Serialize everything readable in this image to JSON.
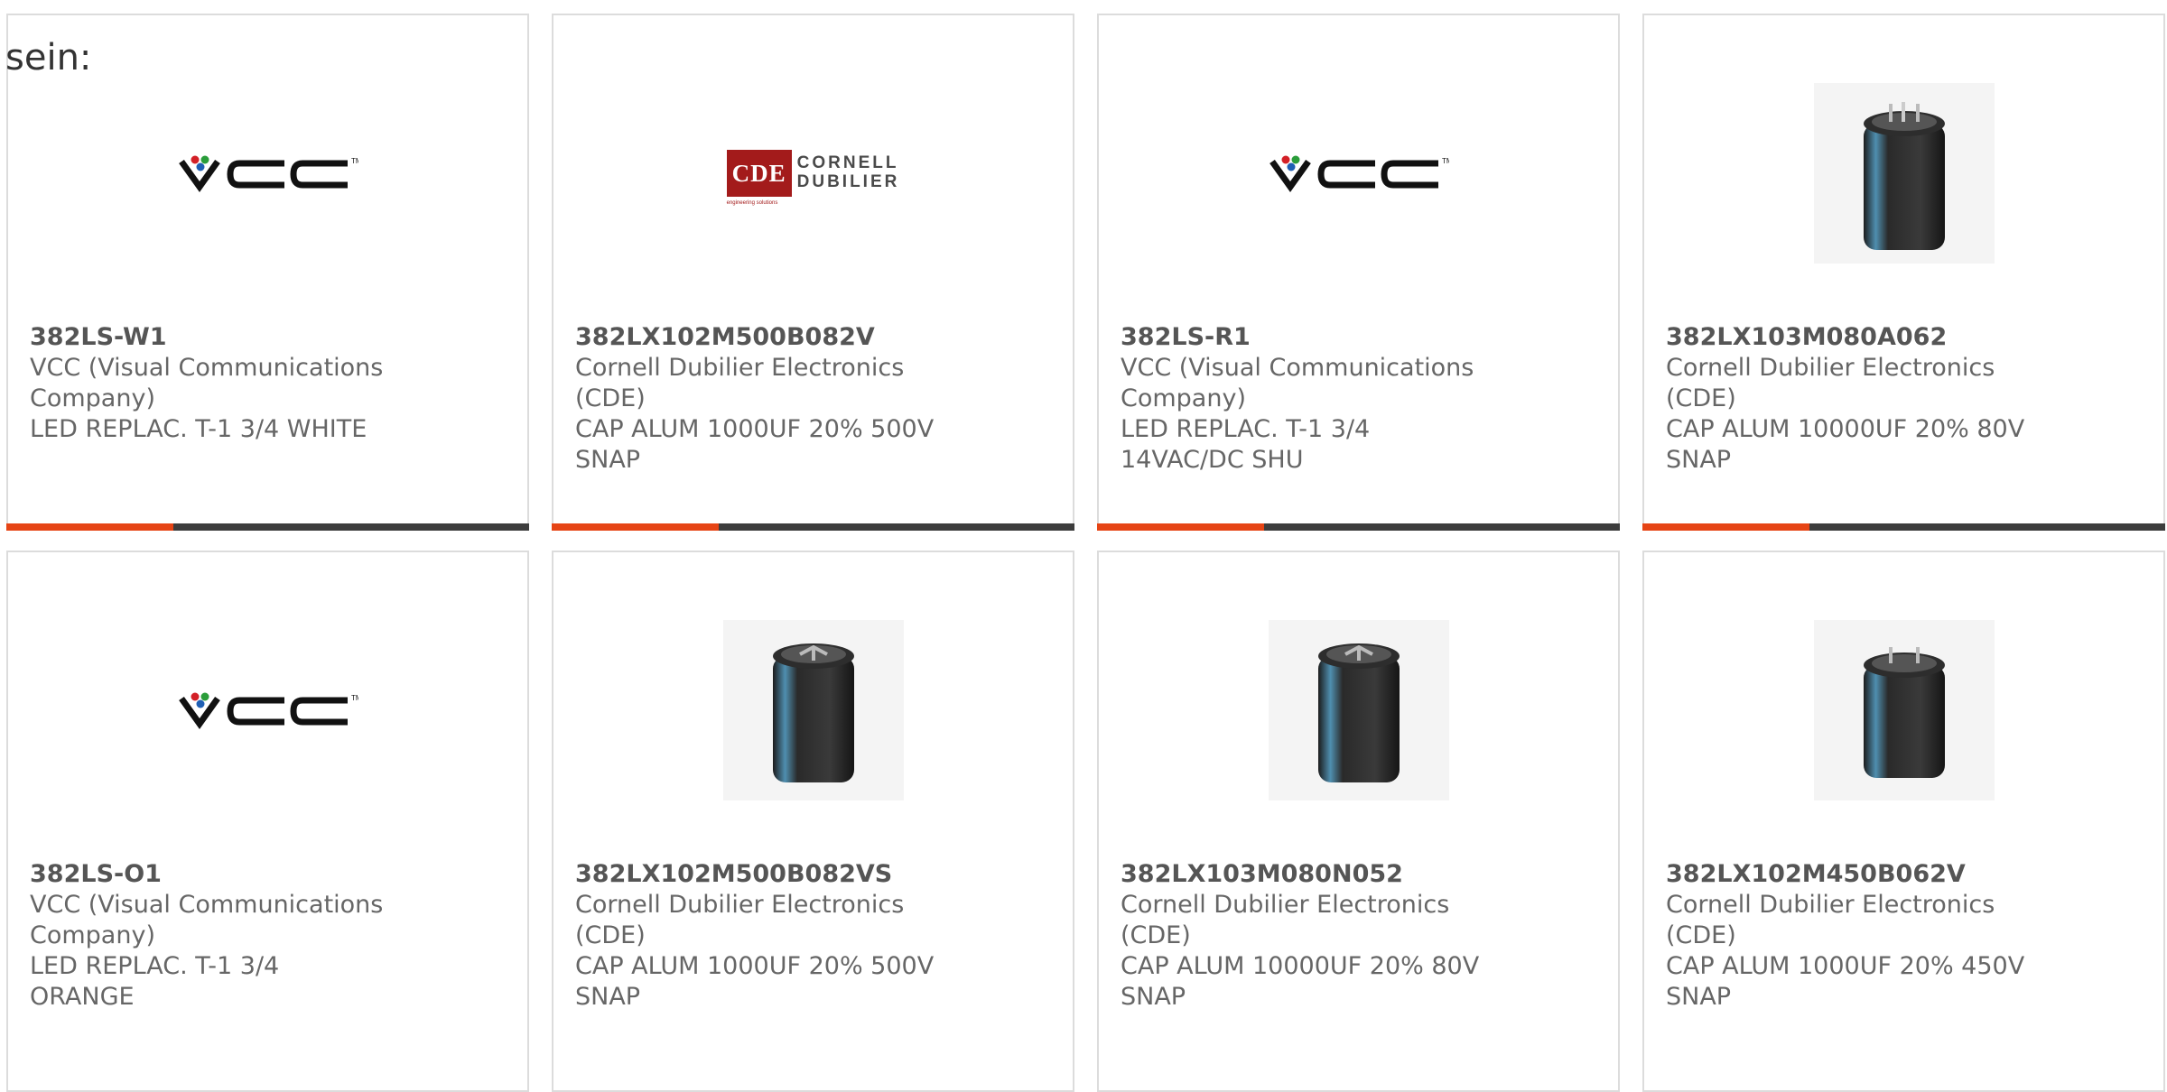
{
  "intro_text": "sein:",
  "colors": {
    "accent": "#e64415",
    "bar_dark": "#3d3d3d",
    "card_border": "#dcdcdc",
    "cde_red": "#a31b1b"
  },
  "cards": [
    {
      "part_number": "382LS-W1",
      "manufacturer": "VCC (Visual Communications Company)",
      "description": "LED REPLAC. T-1 3/4 WHITE",
      "image": "vcc-logo",
      "progress": 0.32
    },
    {
      "part_number": "382LX102M500B082V",
      "manufacturer": "Cornell Dubilier Electronics (CDE)",
      "description": "CAP ALUM 1000UF 20% 500V SNAP",
      "image": "cde-logo",
      "progress": 0.32
    },
    {
      "part_number": "382LS-R1",
      "manufacturer": "VCC (Visual Communications Company)",
      "description": "LED REPLAC. T-1 3/4 14VAC/DC SHU",
      "image": "vcc-logo",
      "progress": 0.32
    },
    {
      "part_number": "382LX103M080A062",
      "manufacturer": "Cornell Dubilier Electronics (CDE)",
      "description": "CAP ALUM 10000UF 20% 80V SNAP",
      "image": "capacitor-photo",
      "progress": 0.32
    },
    {
      "part_number": "382LS-O1",
      "manufacturer": "VCC (Visual Communications Company)",
      "description": "LED REPLAC. T-1 3/4 ORANGE",
      "image": "vcc-logo"
    },
    {
      "part_number": "382LX102M500B082VS",
      "manufacturer": "Cornell Dubilier Electronics (CDE)",
      "description": "CAP ALUM 1000UF 20% 500V SNAP",
      "image": "capacitor-photo"
    },
    {
      "part_number": "382LX103M080N052",
      "manufacturer": "Cornell Dubilier Electronics (CDE)",
      "description": "CAP ALUM 10000UF 20% 80V SNAP",
      "image": "capacitor-photo"
    },
    {
      "part_number": "382LX102M450B062V",
      "manufacturer": "Cornell Dubilier Electronics (CDE)",
      "description": "CAP ALUM 1000UF 20% 450V SNAP",
      "image": "capacitor-photo"
    }
  ],
  "logos": {
    "vcc_text": "VCC",
    "cde_box_text": "CDE",
    "cde_name_line1": "CORNELL",
    "cde_name_line2": "DUBILIER",
    "cde_tagline": "engineering solutions"
  }
}
